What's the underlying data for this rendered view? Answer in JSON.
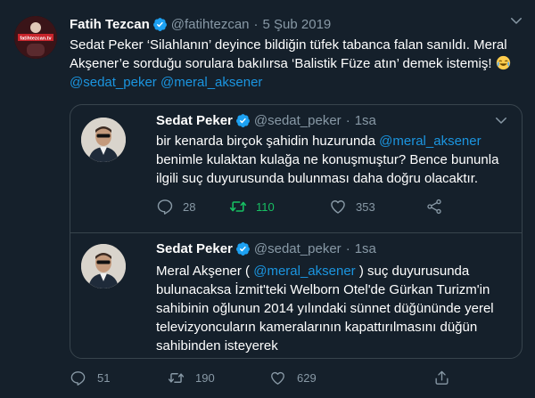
{
  "tweet": {
    "display_name": "Fatih Tezcan",
    "handle": "@fatihtezcan",
    "separator": "·",
    "date": "5 Şub 2019",
    "text_part1": "Sedat Peker ‘Silahlanın’ deyince bildiğin tüfek tabanca falan sanıldı. Meral Akşener’e sorduğu sorulara bakılırsa ‘Balistik Füze atın’ demek istemiş!",
    "emoji": "face-with-tears-of-joy-icon",
    "mention1": "@sedat_peker",
    "mention2": "@meral_aksener",
    "avatar_logo_text": "fatihtezcan.tv",
    "counts": {
      "reply": "51",
      "retweet": "190",
      "like": "629"
    }
  },
  "quote1": {
    "display_name": "Sedat Peker",
    "handle": "@sedat_peker",
    "separator": "·",
    "time": "1sa",
    "text_before": "bir kenarda birçok şahidin huzurunda ",
    "mention": "@meral_aksener",
    "text_after": " benimle kulaktan kulağa ne konuşmuştur? Bence bununla ilgili suç duyurusunda bulunması daha doğru olacaktır.",
    "counts": {
      "reply": "28",
      "retweet": "110",
      "like": "353"
    }
  },
  "quote2": {
    "display_name": "Sedat Peker",
    "handle": "@sedat_peker",
    "separator": "·",
    "time": "1sa",
    "text_before": "Meral Akşener ( ",
    "mention": "@meral_aksener",
    "text_after": " )  suç duyurusunda bulunacaksa İzmit'teki Welborn Otel'de Gürkan Turizm'in sahibinin oğlunun 2014 yılındaki sünnet düğününde yerel televizyoncuların  kameralarının kapattırılmasını düğün sahibinden isteyerek"
  },
  "colors": {
    "background": "#15202b",
    "text": "#ffffff",
    "secondary": "#8899a6",
    "link": "#1b95e0",
    "retweet_green": "#17bf63",
    "border": "#38444d",
    "verified": "#1da1f2"
  }
}
